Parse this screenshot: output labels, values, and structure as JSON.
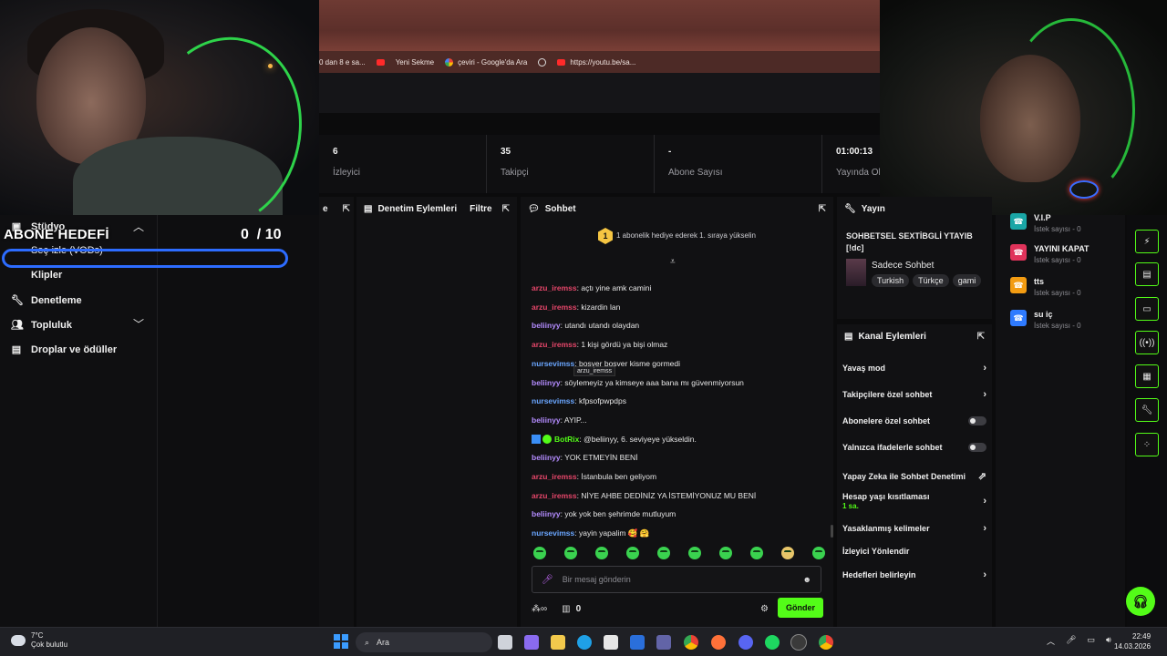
{
  "browser": {
    "bookmarks": [
      {
        "label": "0 dan 8 e sa...",
        "icon": "generic"
      },
      {
        "label": "",
        "icon": "youtube-icon"
      },
      {
        "label": "Yeni Sekme",
        "icon": "blank"
      },
      {
        "label": "çeviri - Google'da Ara",
        "icon": "google-icon"
      },
      {
        "label": "",
        "icon": "globe-icon"
      },
      {
        "label": "https://youtu.be/sa...",
        "icon": "youtube-icon"
      }
    ]
  },
  "stats": [
    {
      "value": "6",
      "label": "İzleyici"
    },
    {
      "value": "35",
      "label": "Takipçi"
    },
    {
      "value": "-",
      "label": "Abone Sayısı"
    },
    {
      "value": "01:00:13",
      "label": "Yayında Ol"
    }
  ],
  "sidebar": {
    "items": [
      {
        "label": "Stüdyo",
        "icon": "studio-icon"
      },
      {
        "label": "Seç-izle (VODs)",
        "icon": ""
      },
      {
        "label": "Klipler",
        "icon": ""
      },
      {
        "label": "Denetleme",
        "icon": "wrench-icon"
      },
      {
        "label": "Topluluk",
        "icon": "community-icon"
      },
      {
        "label": "Droplar ve ödüller",
        "icon": "gift-icon"
      }
    ]
  },
  "goal": {
    "title": "ABONE HEDEFİ",
    "count": "0",
    "target": "/ 10",
    "progress": 0.0
  },
  "panels": {
    "stub_title": "e",
    "denetim": {
      "title": "Denetim Eylemleri",
      "filter": "Filtre"
    },
    "chat": {
      "title": "Sohbet",
      "banner_badge": "1",
      "banner": "1 abonelik hediye ederek 1. sıraya yükselin"
    },
    "mod": {
      "title": "Yayın",
      "stream_title": "SOHBETSEL SEXTİBGLİ YTAYIB [!dc]",
      "category": "Sadece Sohbet",
      "tags": [
        "Turkish",
        "Türkçe",
        "gami"
      ]
    },
    "kanal": {
      "title": "Kanal Eylemleri",
      "items": [
        {
          "label": "Yavaş mod",
          "control": "arrow"
        },
        {
          "label": "Takipçilere özel sohbet",
          "control": "arrow"
        },
        {
          "label": "Abonelere özel sohbet",
          "control": "toggle"
        },
        {
          "label": "Yalnızca ifadelerle sohbet",
          "control": "toggle"
        },
        {
          "label": "Yapay Zeka ile Sohbet Denetimi",
          "control": "external"
        },
        {
          "label": "Hesap yaşı kısıtlaması",
          "sub": "1 sa.",
          "control": "arrow"
        },
        {
          "label": "Yasaklanmış kelimeler",
          "control": "arrow"
        },
        {
          "label": "İzleyici Yönlendir",
          "control": "none"
        },
        {
          "label": "Hedefleri belirleyin",
          "control": "arrow"
        }
      ]
    }
  },
  "chat": {
    "messages": [
      {
        "user": "arzu_iremss",
        "color": "#e6466a",
        "text": ": açtı yine amk camini"
      },
      {
        "user": "arzu_iremss",
        "color": "#e6466a",
        "text": ": kizardin lan"
      },
      {
        "user": "beliinyy",
        "color": "#b48cff",
        "text": ": utandı utandı olaydan"
      },
      {
        "user": "arzu_iremss",
        "color": "#e6466a",
        "text": ": 1 kişi gördü ya bişi olmaz"
      },
      {
        "user": "nursevimss",
        "color": "#6aa6ff",
        "text": ": boşver boşver kisme gormedi"
      },
      {
        "user": "beliinyy",
        "color": "#b48cff",
        "text": ": söylemeyiz ya kimseye aaa bana mı güvenmiyorsun"
      },
      {
        "user": "nursevimss",
        "color": "#6aa6ff",
        "text": ": kfpsofpwpdps"
      },
      {
        "user": "beliinyy",
        "color": "#b48cff",
        "text": ": AYIP..."
      },
      {
        "user": "BotRix",
        "color": "#53fc18",
        "text": ": @beliinyy, 6. seviyeye yükseldin."
      },
      {
        "user": "beliinyy",
        "color": "#b48cff",
        "text": ": YOK ETMEYİN BENİ"
      },
      {
        "user": "arzu_iremss",
        "color": "#e6466a",
        "text": ": İstanbula ben geliyom"
      },
      {
        "user": "arzu_iremss",
        "color": "#e6466a",
        "text": ": NİYE AHBE DEDİNİZ YA İSTEMİYONUZ MU BENİ"
      },
      {
        "user": "beliinyy",
        "color": "#b48cff",
        "text": ": yok yok ben şehrimde mutluyum"
      },
      {
        "user": "nursevimss",
        "color": "#6aa6ff",
        "text": ": yayin yapalim 🥰 🤗"
      }
    ],
    "tooltip": "arzu_iremss",
    "input_placeholder": "Bir mesaj gönderin",
    "points": "0",
    "send_label": "Gönder"
  },
  "actions": [
    {
      "name": "V.I.P",
      "count": "İstek sayısı - 0",
      "color": "#1aa6a6"
    },
    {
      "name": "YAYINI KAPAT",
      "count": "İstek sayısı - 0",
      "color": "#e0335a"
    },
    {
      "name": "tts",
      "count": "İstek sayısı - 0",
      "color": "#f39c12"
    },
    {
      "name": "su iç",
      "count": "İstek sayısı - 0",
      "color": "#2f7bff"
    }
  ],
  "taskbar": {
    "temp": "7°C",
    "weather": "Çok bulutlu",
    "search": "Ara",
    "time": "22:49",
    "date": "14.03.2026"
  },
  "colors": {
    "accent": "#53fc18",
    "goal_border": "#2d6cff"
  }
}
